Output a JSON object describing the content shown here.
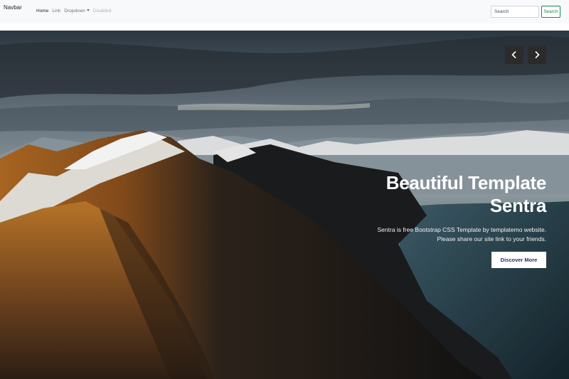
{
  "navbar": {
    "brand": "Navbar",
    "links": [
      {
        "label": "Home"
      },
      {
        "label": "Link"
      },
      {
        "label": "Dropdown"
      },
      {
        "label": "Disabled"
      }
    ],
    "search_placeholder": "Search",
    "search_button": "Search"
  },
  "hero": {
    "title_line1": "Beautiful Template",
    "title_line2": "Sentra",
    "desc_line1": "Sentra is free Bootstrap CSS Template by templatemo website.",
    "desc_line2": "Please share our site link to your friends.",
    "cta": "Discover More"
  },
  "colors": {
    "navbar_bg": "#f8f9fa",
    "search_accent": "#198754",
    "cta_text": "#2b2b6b"
  },
  "icons": [
    "chevron-left-icon",
    "chevron-right-icon",
    "caret-down-icon"
  ]
}
